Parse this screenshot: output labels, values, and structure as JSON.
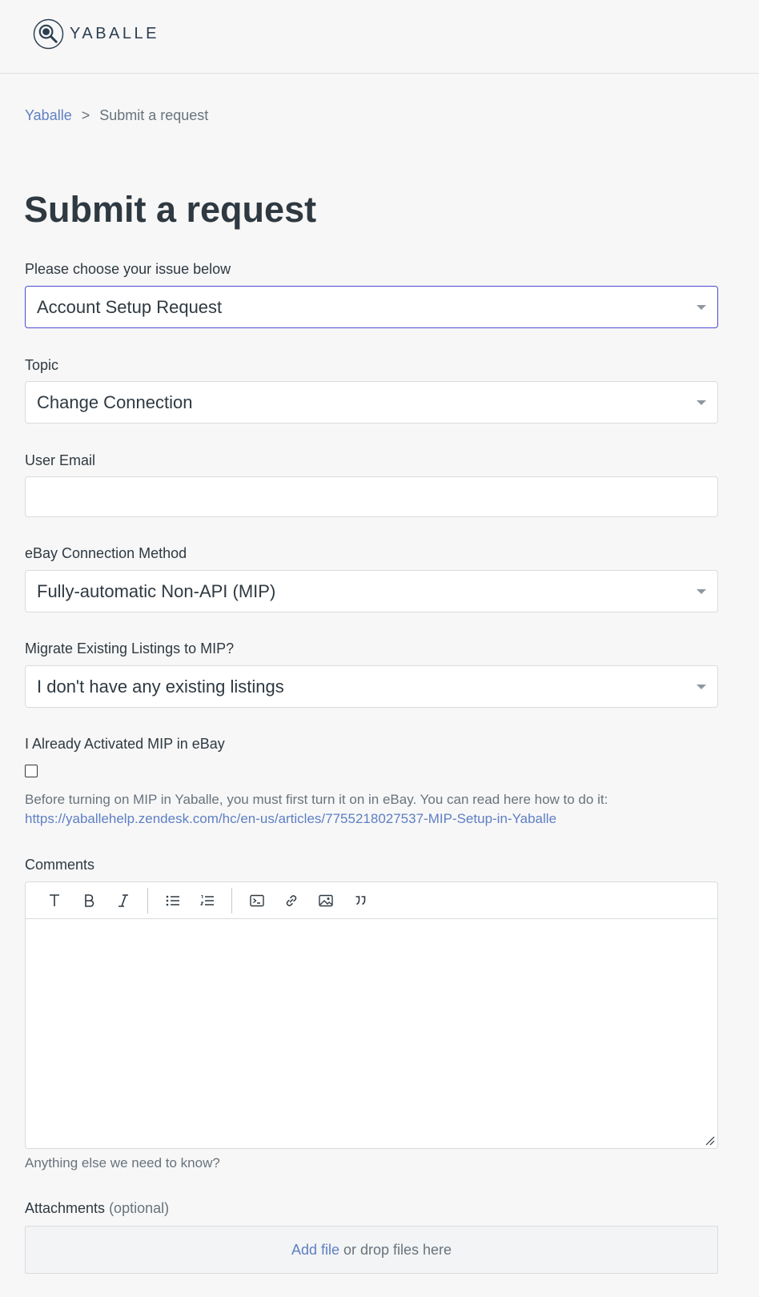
{
  "brand": {
    "name": "YABALLE"
  },
  "breadcrumb": {
    "home": "Yaballe",
    "separator": ">",
    "current": "Submit a request"
  },
  "page": {
    "title": "Submit a request"
  },
  "form": {
    "issue": {
      "label": "Please choose your issue below",
      "value": "Account Setup Request"
    },
    "topic": {
      "label": "Topic",
      "value": "Change Connection"
    },
    "email": {
      "label": "User Email",
      "value": ""
    },
    "connection_method": {
      "label": "eBay Connection Method",
      "value": "Fully-automatic Non-API (MIP)"
    },
    "migrate": {
      "label": "Migrate Existing Listings to MIP?",
      "value": "I don't have any existing listings"
    },
    "mip_activated": {
      "label": "I Already Activated MIP in eBay",
      "checked": false,
      "hint_text": "Before turning on MIP in Yaballe, you must first turn it on in eBay. You can read here how to do it:",
      "hint_link": "https://yaballehelp.zendesk.com/hc/en-us/articles/7755218027537-MIP-Setup-in-Yaballe"
    },
    "comments": {
      "label": "Comments",
      "value": "",
      "hint": "Anything else we need to know?",
      "toolbar": [
        "text-icon",
        "bold-icon",
        "italic-icon",
        "bulleted-list-icon",
        "numbered-list-icon",
        "code-block-icon",
        "link-icon",
        "image-icon",
        "quote-icon"
      ]
    },
    "attachments": {
      "label": "Attachments",
      "optional": "(optional)",
      "add_file": "Add file",
      "drop_text": "or drop files here"
    }
  }
}
